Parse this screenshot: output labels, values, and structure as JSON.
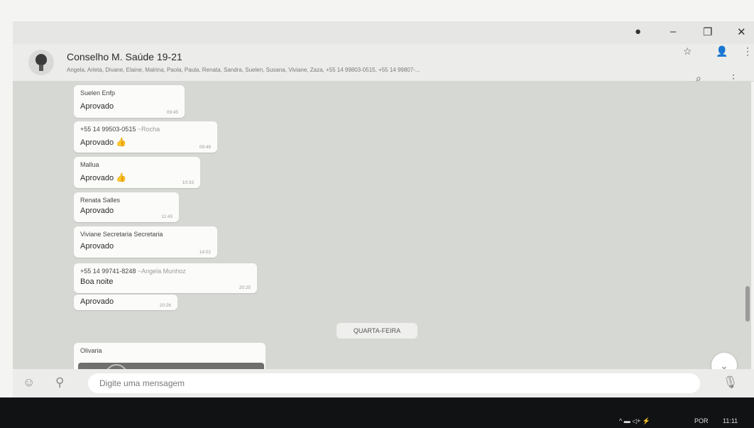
{
  "window": {
    "controls": [
      "●",
      "–",
      "❐",
      "✕"
    ]
  },
  "header": {
    "title": "Conselho M. Saúde 19-21",
    "members": "Angela, Arleta, Divane, Elaine, Malrina, Paola, Paula, Renata, Sandra, Suelen, Susana, Viviane, Zaza, +55 14 99803-0515, +55 14 99807-...",
    "icons": [
      "lightbulb-avatar",
      "star-icon",
      "person-icon",
      "menu-dots-icon",
      "search-icon",
      "menu-dots-icon"
    ]
  },
  "messages": [
    {
      "sender": "Suelen Enfp",
      "alias": "",
      "text": "Aprovado",
      "time": "09:45",
      "thumb": false
    },
    {
      "sender": "+55 14 99503-0515",
      "alias": "~Rocha",
      "text": "Aprovado",
      "time": "09:49",
      "thumb": true
    },
    {
      "sender": "Mallua",
      "alias": "",
      "text": "Aprovado",
      "time": "10:33",
      "thumb": true
    },
    {
      "sender": "Renata Salles",
      "alias": "",
      "text": "Aprovado",
      "time": "11:43",
      "thumb": false
    },
    {
      "sender": "Viviane Secretaria Secretaria",
      "alias": "",
      "text": "Aprovado",
      "time": "14:02",
      "thumb": false
    },
    {
      "sender": "+55 14 99741-8248",
      "alias": "~Angela Munhoz",
      "text": "Boa noite",
      "time": "20:25",
      "thumb": false
    },
    {
      "sender": "",
      "alias": "",
      "text": "Aprovado",
      "time": "20:26",
      "thumb": false
    }
  ],
  "day_divider": "QUARTA-FEIRA",
  "last_message": {
    "sender": "Olivaria"
  },
  "composer": {
    "placeholder": "Digite uma mensagem"
  },
  "taskbar": {
    "language": "POR",
    "clock": "11:11",
    "tray_symbols": "^  ▬  ◁+  ⚡"
  },
  "colors": {
    "chat_background": "#d6d8d3",
    "bubble": "#fbfbfa",
    "taskbar": "#111213"
  }
}
